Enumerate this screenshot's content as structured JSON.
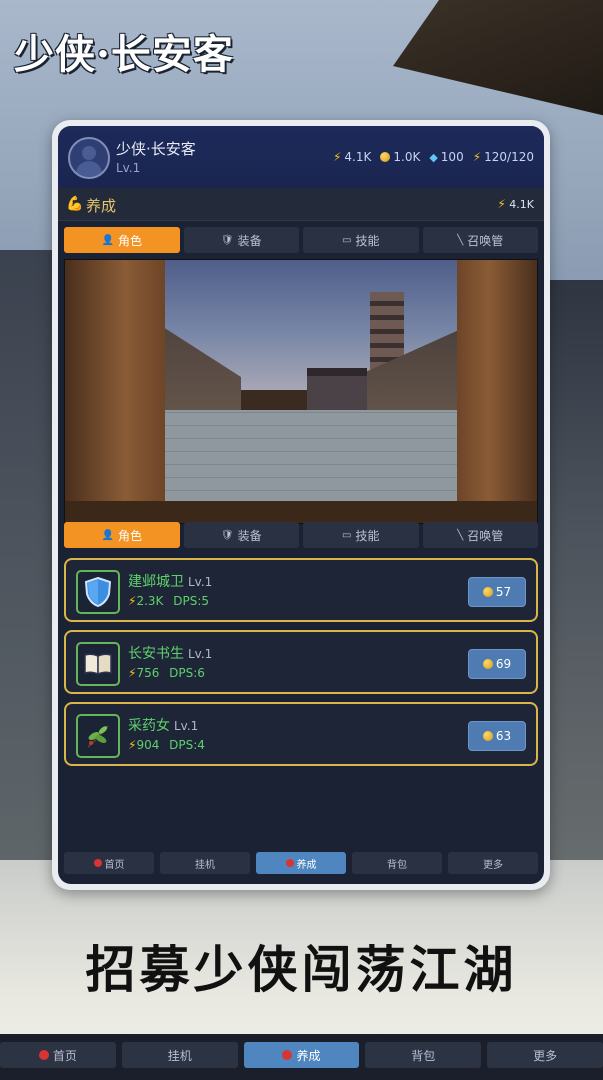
{
  "logo_text": "少侠·长安客",
  "slogan": "招募少侠闯荡江湖",
  "player": {
    "name": "少侠·长安客",
    "level": "Lv.1"
  },
  "resources": {
    "energy": "4.1K",
    "coins": "1.0K",
    "gems": "100",
    "stamina": "120/120"
  },
  "section": {
    "title": "养成",
    "energy": "4.1K"
  },
  "tabs": [
    "角色",
    "装备",
    "技能",
    "召唤管"
  ],
  "heroes": [
    {
      "name": "建邺城卫",
      "level": "Lv.1",
      "power": "2.3K",
      "dps": "DPS:5",
      "price": "57",
      "icon": "shield-icon"
    },
    {
      "name": "长安书生",
      "level": "Lv.1",
      "power": "756",
      "dps": "DPS:6",
      "price": "69",
      "icon": "book-icon"
    },
    {
      "name": "采药女",
      "level": "Lv.1",
      "power": "904",
      "dps": "DPS:4",
      "price": "63",
      "icon": "herb-icon"
    }
  ],
  "nav": [
    "首页",
    "挂机",
    "养成",
    "背包",
    "更多"
  ],
  "colors": {
    "accent_orange": "#f39324",
    "active_blue": "#4f86c0",
    "hero_green": "#5fd06e",
    "card_border_gold": "#d9b54a"
  }
}
